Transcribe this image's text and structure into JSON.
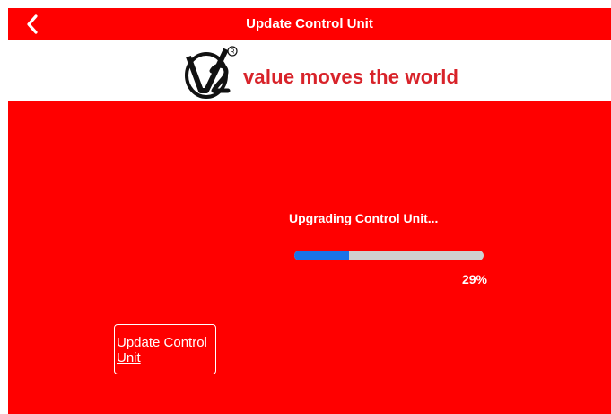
{
  "header": {
    "title": "Update Control Unit",
    "back_icon": "chevron-left-icon"
  },
  "brand": {
    "logo_text": "V2",
    "tagline": "value moves the world",
    "tagline_color": "#d8232a"
  },
  "colors": {
    "primary": "#ff0000",
    "progress_fill": "#1a73e8",
    "progress_track": "#cfcfcf"
  },
  "progress": {
    "status": "Upgrading Control Unit...",
    "percent_label": "29%",
    "value": 0.29
  },
  "action": {
    "label": "Update Control Unit"
  }
}
